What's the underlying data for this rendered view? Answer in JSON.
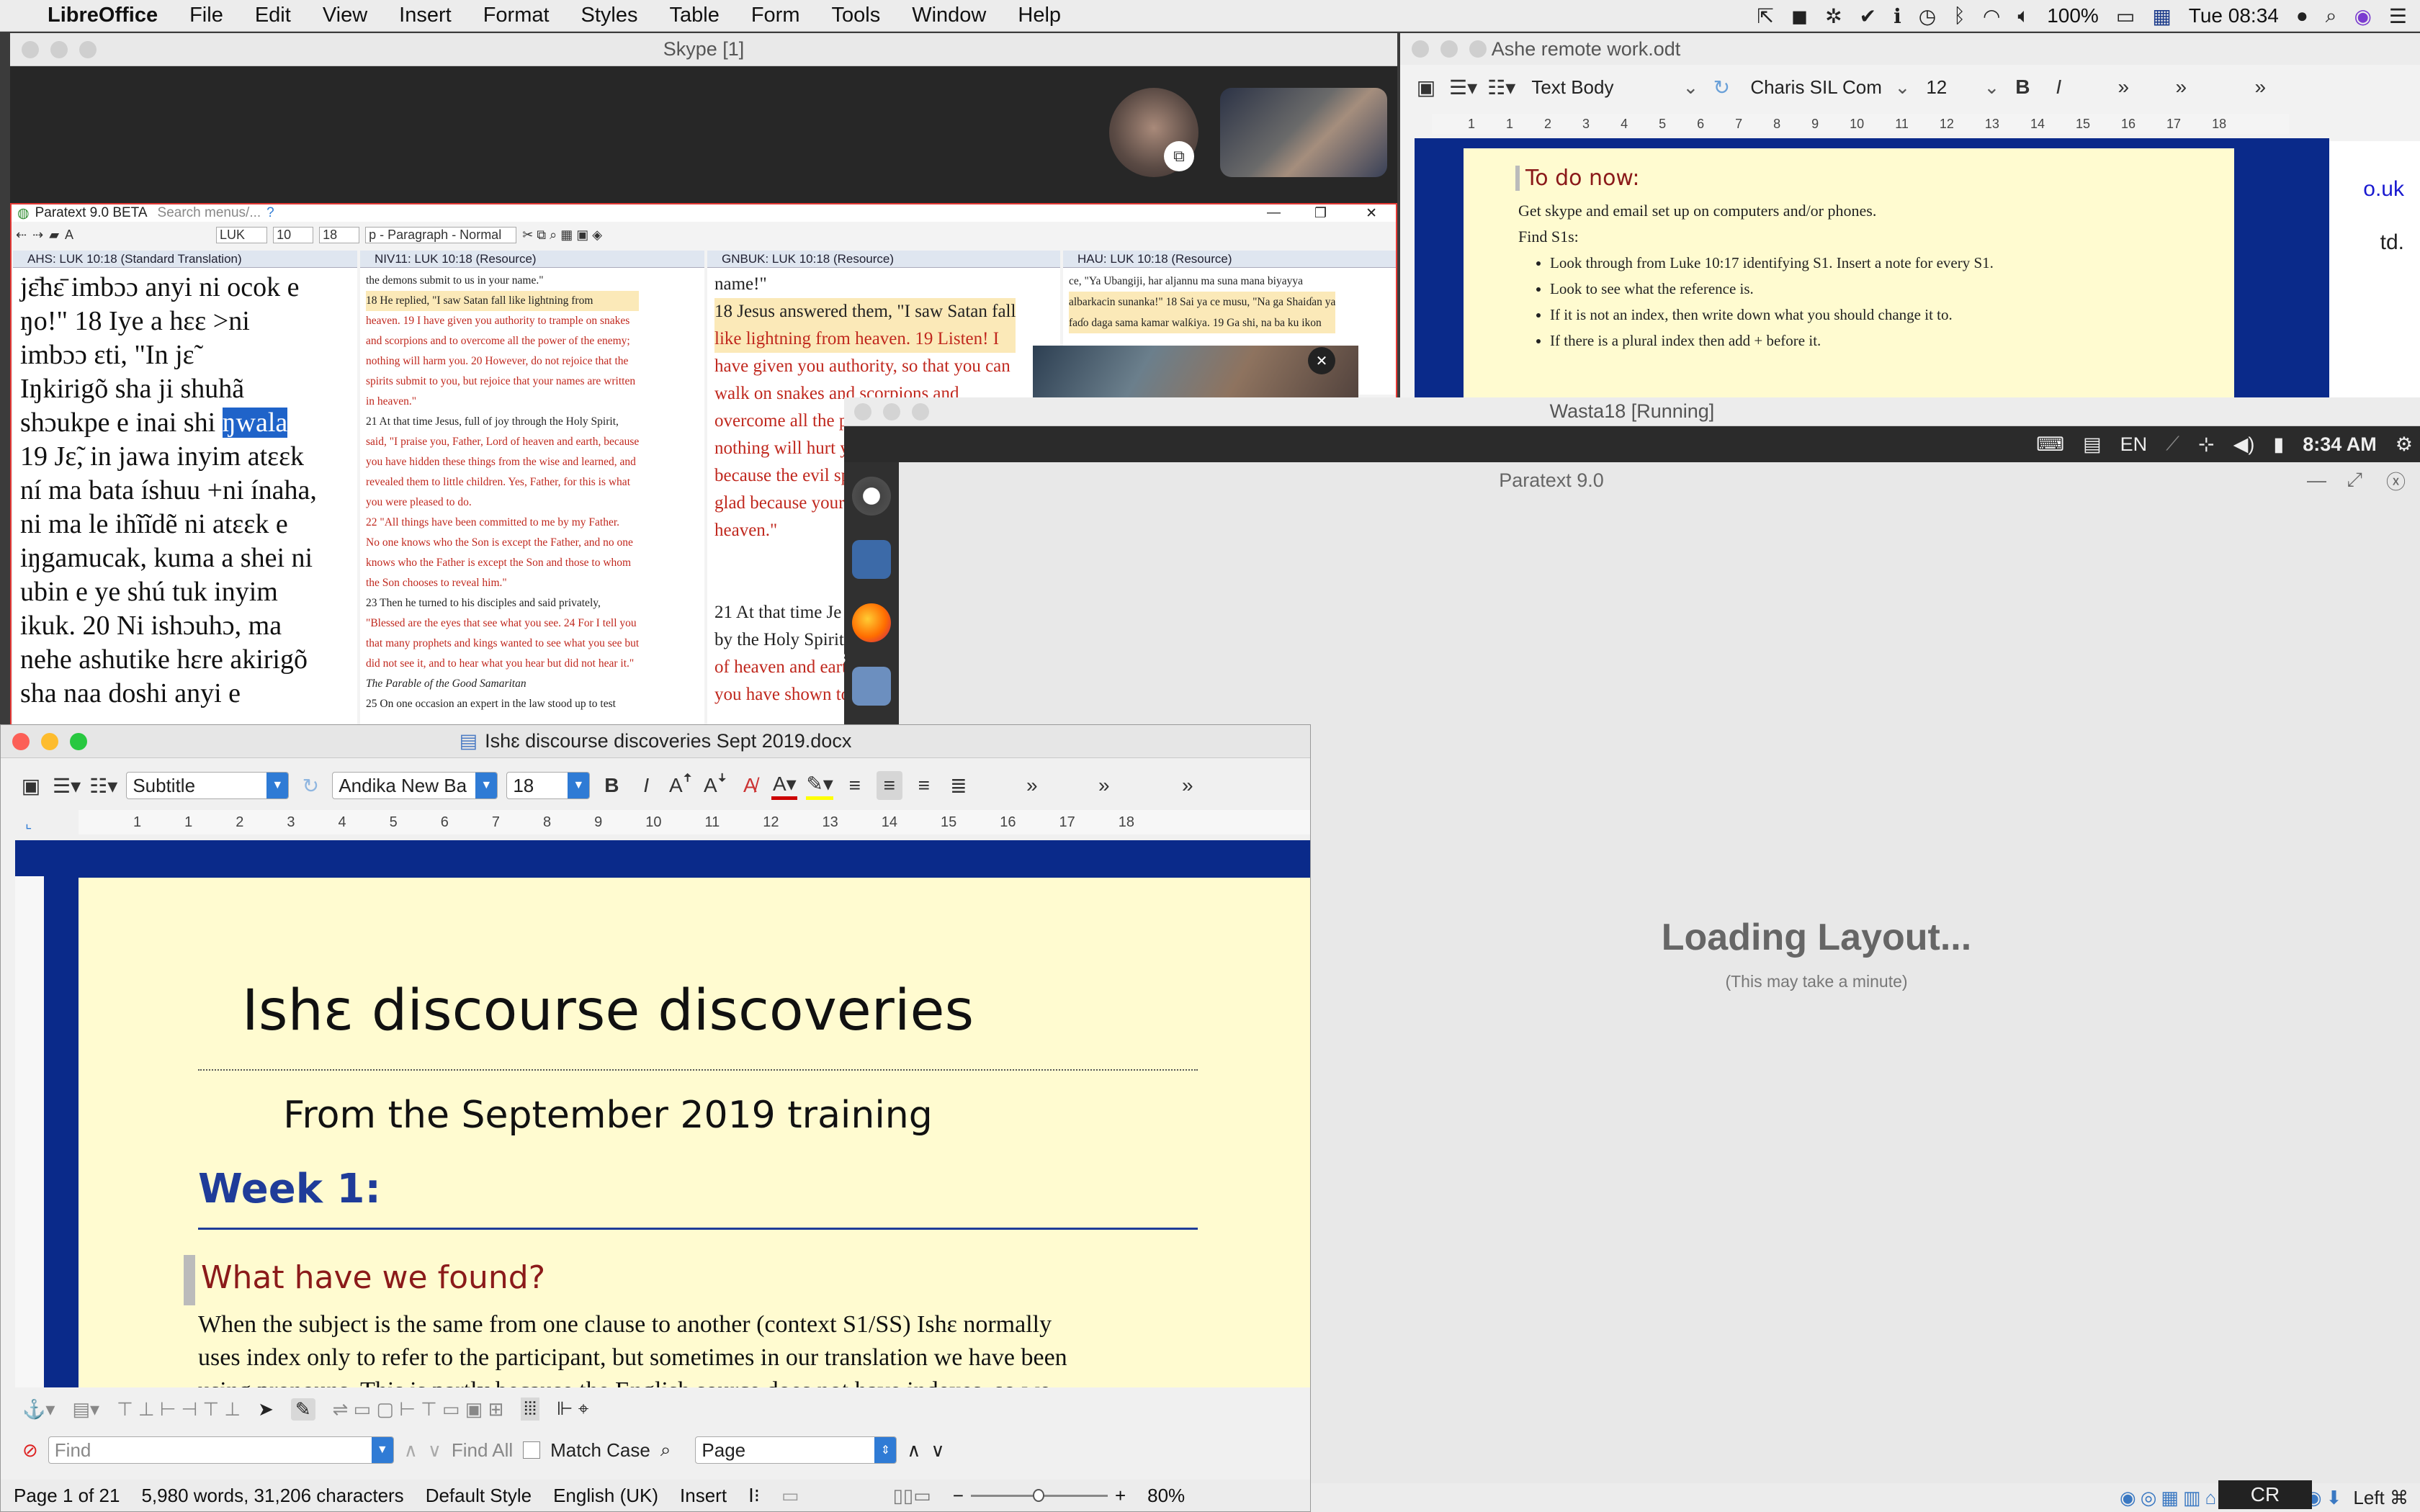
{
  "menubar": {
    "app": "LibreOffice",
    "items": [
      "File",
      "Edit",
      "View",
      "Insert",
      "Format",
      "Styles",
      "Table",
      "Form",
      "Tools",
      "Window",
      "Help"
    ],
    "battery": "100%",
    "clock": "Tue 08:34"
  },
  "skype": {
    "title": "Skype [1]"
  },
  "paratext": {
    "title": "Paratext 9.0 BETA",
    "search_placeholder": "Search menus/...",
    "book": "LUK",
    "chapter": "10",
    "verse": "18",
    "style": "p - Paragraph - Normal",
    "panes": [
      {
        "title": "AHS: LUK 10:18 (Standard Translation)",
        "lines": [
          "jɛ̄hɛ̄ imbɔɔ anyi ni ocok e",
          "ŋo!\" 18 Iye a hɛɛ >ni",
          "imbɔɔ ɛti, \"In jɛ̃",
          "Iŋkirigõ sha ji shuhã",
          "shɔukpe e inai shi",
          "19 Jɛ̃, in jawa inyim atɛɛk",
          "ní ma bata íshuu +ni ínaha,",
          "ni ma le ihĩĩdẽ ni atɛɛk e",
          "iŋgamucak, kuma a shei ni",
          "ubin e ye shú tuk inyim",
          "ikuk. 20 Ni ishɔuhɔ, ma",
          "nehe ashutike hɛre akirigõ",
          "sha naa doshi anyi e"
        ],
        "selected": "ŋwala"
      },
      {
        "title": "NIV11: LUK 10:18 (Resource)",
        "lines": [
          "the demons submit to us in your name.\"",
          "18 He replied, \"I saw Satan fall like lightning from",
          "heaven. 19 I have given you authority to trample on snakes",
          "and scorpions and to overcome all the power of the enemy;",
          "nothing will harm you. 20 However, do not rejoice that the",
          "spirits submit to you, but rejoice that your names are written",
          "in heaven.\"",
          "21 At that time Jesus, full of joy through the Holy Spirit,",
          "said, \"I praise you, Father, Lord of heaven and earth, because",
          "you have hidden these things from the wise and learned, and",
          "revealed them to little children. Yes, Father, for this is what",
          "you were pleased to do.",
          "22 \"All things have been committed to me by my Father.",
          "No one knows who the Son is except the Father, and no one",
          "knows who the Father is except the Son and those to whom",
          "the Son chooses to reveal him.\"",
          "23 Then he turned to his disciples and said privately,",
          "\"Blessed are the eyes that see what you see. 24 For I tell you",
          "that many prophets and kings wanted to see what you see but",
          "did not see it, and to hear what you hear but did not hear it.\"",
          "The Parable of the Good Samaritan",
          "25 On one occasion an expert in the law stood up to test"
        ]
      },
      {
        "title": "GNBUK: LUK 10:18 (Resource)",
        "lines": [
          "name!\"",
          "18 Jesus answered them, \"I saw Satan fall",
          "like lightning from heaven. 19 Listen! I",
          "have given you authority, so that you can",
          "walk on snakes and scorpions and",
          "overcome all the p",
          "nothing will hurt y",
          "because the evil sp",
          "glad because your",
          "heaven.\"",
          "Jesu",
          "(Mt 11.2",
          "21 At that time Je",
          "by the Holy Spirit",
          "of heaven and eart",
          "you have shown to"
        ]
      },
      {
        "title": "HAU: LUK 10:18 (Resource)",
        "lines": [
          "ce, \"Ya Ubangiji, har aljannu ma suna mana biyayya",
          "albarkacin sunanka!\" 18 Sai ya ce musu, \"Na ga Shaiɗan ya",
          "faɗo daga sama kamar walƙiya. 19 Ga shi, na ba ku ikon"
        ]
      }
    ]
  },
  "ashe": {
    "title": "Ashe remote work.odt",
    "style": "Text Body",
    "font": "Charis SIL Com",
    "size": "12",
    "heading": "To do now:",
    "lines": [
      "Get skype and email set up on computers and/or phones.",
      "Find S1s:"
    ],
    "bullets": [
      "Look through from Luke 10:17 identifying S1. Insert a note for every S1.",
      "Look to see what the reference is.",
      "If it is not an index, then write down what you should change it to.",
      "If there is a plural index then add + before it."
    ],
    "bold_phrase": "Insert a note",
    "side_text": [
      "o.uk",
      "td."
    ],
    "ruler": [
      "1",
      "1",
      "2",
      "3",
      "4",
      "5",
      "6",
      "7",
      "8",
      "9",
      "10",
      "11",
      "12",
      "13",
      "14",
      "15",
      "16",
      "17",
      "18"
    ]
  },
  "wasta": {
    "title": "Wasta18 [Running]",
    "lang": "EN",
    "clock": "8:34 AM",
    "app_title": "Paratext 9.0",
    "loading": "Loading Layout...",
    "loading_sub": "(This may take a minute)",
    "dock_badge": "3",
    "status_right": "Left ⌘",
    "cr": "CR"
  },
  "writer": {
    "title": "Ishɛ discourse discoveries Sept 2019.docx",
    "style": "Subtitle",
    "font": "Andika New Ba",
    "size": "18",
    "ruler": [
      "1",
      "1",
      "2",
      "3",
      "4",
      "5",
      "6",
      "7",
      "8",
      "9",
      "10",
      "11",
      "12",
      "13",
      "14",
      "15",
      "16",
      "17",
      "18"
    ],
    "doc": {
      "title": "Ishɛ discourse discoveries",
      "subtitle": "From the September 2019 training",
      "week": "Week 1:",
      "question": "What have we found?",
      "body": [
        "When the subject is the same from one clause to another (context S1/SS) Ishɛ normally",
        "uses index only to refer to the participant, but sometimes in our translation we have been",
        "using pronouns. This is partly because the English source does not have indexes, so we"
      ]
    },
    "find": {
      "placeholder": "Find",
      "find_all": "Find All",
      "match_case": "Match Case",
      "search_in": "Page"
    },
    "status": {
      "page": "Page 1 of 21",
      "words": "5,980 words, 31,206 characters",
      "style": "Default Style",
      "lang": "English (UK)",
      "mode": "Insert",
      "zoom": "80%"
    }
  },
  "colors": {
    "page_bg": "#fffbd0",
    "doc_blue": "#0a2a8a",
    "week_blue": "#1f3c99",
    "heading_red": "#8b1a1a",
    "red_text": "#c0281e",
    "accent": "#2f7bd5"
  }
}
